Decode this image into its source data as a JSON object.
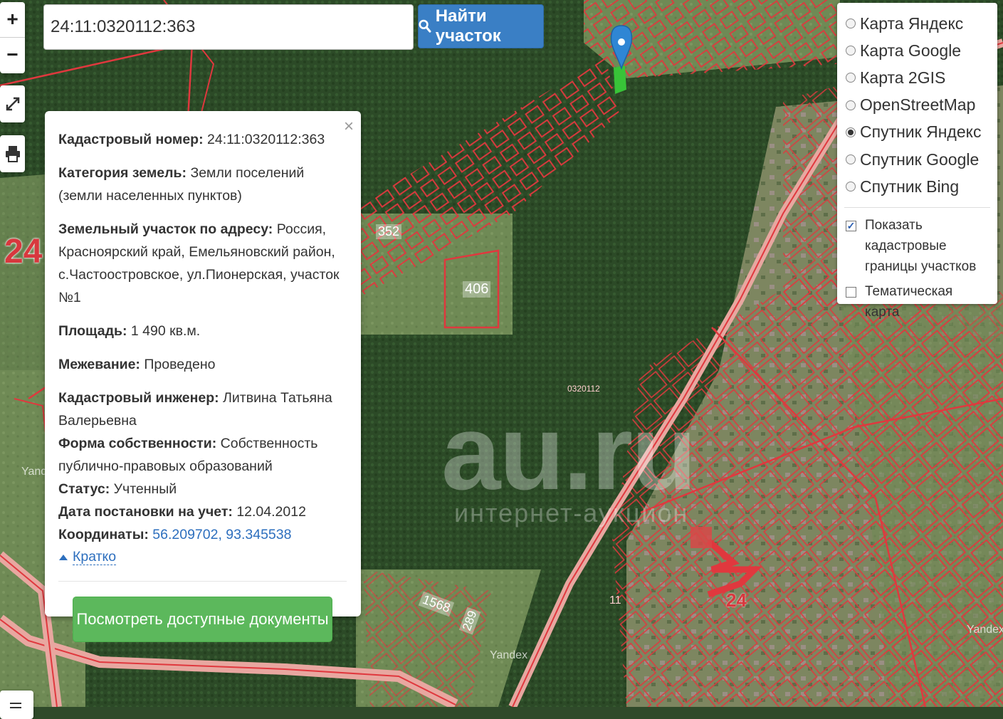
{
  "search": {
    "value": "24:11:0320112:363",
    "button_label": "Найти участок"
  },
  "zoom": {
    "in_label": "+",
    "out_label": "−"
  },
  "layers": {
    "options": [
      {
        "label": "Карта Яндекс",
        "selected": false
      },
      {
        "label": "Карта Google",
        "selected": false
      },
      {
        "label": "Карта 2GIS",
        "selected": false
      },
      {
        "label": "OpenStreetMap",
        "selected": false
      },
      {
        "label": "Спутник Яндекс",
        "selected": true
      },
      {
        "label": "Спутник Google",
        "selected": false
      },
      {
        "label": "Спутник Bing",
        "selected": false
      }
    ],
    "show_boundaries": {
      "label": "Показать кадастровые границы участков",
      "checked": true
    },
    "thematic_map": {
      "label": "Тематическая карта",
      "checked": false
    }
  },
  "info": {
    "cadastral_number": {
      "key": "Кадастровый номер:",
      "value": "24:11:0320112:363"
    },
    "land_category": {
      "key": "Категория земель:",
      "value": "Земли поселений (земли населенных пунктов)"
    },
    "address": {
      "key": "Земельный участок по адресу:",
      "value": "Россия, Красноярский край, Емельяновский район, с.Частоостровское, ул.Пионерская, участок №1"
    },
    "area": {
      "key": "Площадь:",
      "value": "1 490 кв.м."
    },
    "survey": {
      "key": "Межевание:",
      "value": "Проведено"
    },
    "engineer": {
      "key": "Кадастровый инженер:",
      "value": "Литвина Татьяна Валерьевна"
    },
    "ownership": {
      "key": "Форма собственности:",
      "value": "Собственность публично-правовых образований"
    },
    "status": {
      "key": "Статус:",
      "value": "Учтенный"
    },
    "registration_date": {
      "key": "Дата постановки на учет:",
      "value": "12.04.2012"
    },
    "coordinates": {
      "key": "Координаты:",
      "value": "56.209702, 93.345538"
    },
    "collapse_label": "Кратко",
    "close_label": "×",
    "docs_button_label": "Посмотреть доступные документы"
  },
  "map_labels": {
    "region_left": "24",
    "region_center": "24",
    "quarter": "0320112",
    "parcel_406": "406",
    "parcel_352": "352",
    "parcel_1568": "1568",
    "parcel_289": "289",
    "parcel_11": "11",
    "yandex_left": "Yandex",
    "yandex_right": "Yandex",
    "yandex_bottom": "Yandex"
  },
  "watermark": {
    "brand": "au.ru",
    "tagline": "интернет-аукцион"
  },
  "colors": {
    "boundary": "#e0383e",
    "accent_blue": "#3a7fc5",
    "docs_green": "#5cb85c",
    "link": "#2d6fbe"
  }
}
